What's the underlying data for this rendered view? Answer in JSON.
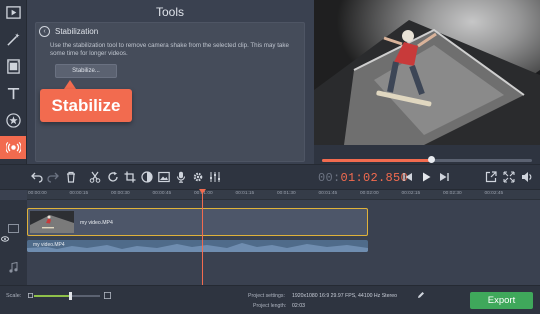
{
  "sidebar": {
    "items": [
      {
        "icon": "import-icon"
      },
      {
        "icon": "magic-wand-icon"
      },
      {
        "icon": "film-icon"
      },
      {
        "icon": "text-icon"
      },
      {
        "icon": "star-icon"
      },
      {
        "icon": "stabilization-icon",
        "active": true
      },
      {
        "icon": "menu-icon"
      }
    ]
  },
  "tools": {
    "title": "Tools",
    "section_title": "Stabilization",
    "description": "Use the stabilization tool to remove camera shake from the selected clip. This may take some time for longer videos.",
    "button_label": "Stabilize...",
    "callout_label": "Stabilize"
  },
  "preview": {
    "seek_progress": 0.52
  },
  "timeline_toolbar": {
    "timecode_dim": "00:",
    "timecode_main": "01:02.850",
    "icons": [
      "undo-icon",
      "redo-icon",
      "delete-icon",
      "cut-icon",
      "rotate-icon",
      "crop-icon",
      "color-icon",
      "image-icon",
      "record-audio-icon",
      "settings-icon",
      "equalizer-icon",
      "previous-icon",
      "play-icon",
      "next-icon",
      "external-icon",
      "fullscreen-icon",
      "volume-icon"
    ]
  },
  "ruler": {
    "ticks": [
      "00:00:00",
      "00:00:15",
      "00:00:30",
      "00:00:45",
      "00:01:00",
      "00:01:15",
      "00:01:30",
      "00:01:45",
      "00:02:00",
      "00:02:15",
      "00:02:30",
      "00:02:45"
    ]
  },
  "timeline": {
    "video_clip_label": "my video.MP4",
    "audio_clip_label": "my video.MP4"
  },
  "bottom": {
    "scale_label": "Scale:",
    "scale_value": 0.55,
    "project_settings_label": "Project settings:",
    "project_settings_value": "1920x1080 16:9 29.97 FPS, 44100 Hz Stereo",
    "project_length_label": "Project length:",
    "project_length_value": "02:03",
    "export_label": "Export"
  },
  "colors": {
    "accent": "#f26b4f",
    "export": "#3fa85b",
    "clip_border": "#e0b23a",
    "audio_clip": "#4f6b8a"
  }
}
